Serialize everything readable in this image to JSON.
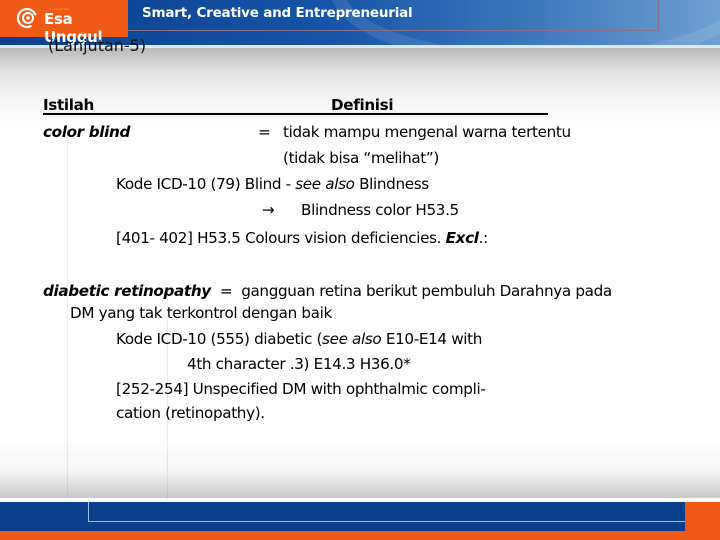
{
  "header": {
    "logo": {
      "small_text": "Universitas",
      "name": "Esa Unggul",
      "icon": "esa-unggul-logo-icon"
    },
    "tagline": "Smart, Creative and Entrepreneurial",
    "colors": {
      "brand_orange": "#f15a16",
      "brand_blue": "#0b3f8c"
    }
  },
  "slide": {
    "subtitle": "(Lanjutan-5)",
    "table_header": {
      "term": "Istilah",
      "definition": "Definisi"
    },
    "entries": [
      {
        "term": "color blind",
        "eq": "=",
        "definition_lines": [
          "tidak mampu mengenal warna tertentu",
          "(tidak bisa “melihat”)"
        ],
        "icd_lines": [
          {
            "prefix": "Kode ICD-10 (79)  Blind  -  ",
            "italic": "see also",
            "suffix": " Blindness"
          },
          {
            "arrow": "→",
            "text": "Blindness color  H53.5"
          },
          {
            "prefix": "[401- 402]  H53.5  Colours vision deficiencies. ",
            "bold_italic": "Excl",
            "suffix": ".:"
          }
        ]
      },
      {
        "term": "diabetic retinopathy",
        "eq": "=",
        "definition_first": "gangguan retina berikut pembuluh Darahnya pada",
        "definition_cont": "DM yang tak terkontrol dengan baik",
        "icd_lines": [
          {
            "prefix": "Kode ICD-10 (555)  diabetic (",
            "italic": "see also",
            "suffix": " E10-E14 with"
          },
          {
            "text": "4th character .3) E14.3   H36.0*"
          },
          {
            "text": "[252-254]  Unspecified DM with ophthalmic compli-"
          },
          {
            "text": "cation (retinopathy)."
          }
        ]
      }
    ]
  }
}
